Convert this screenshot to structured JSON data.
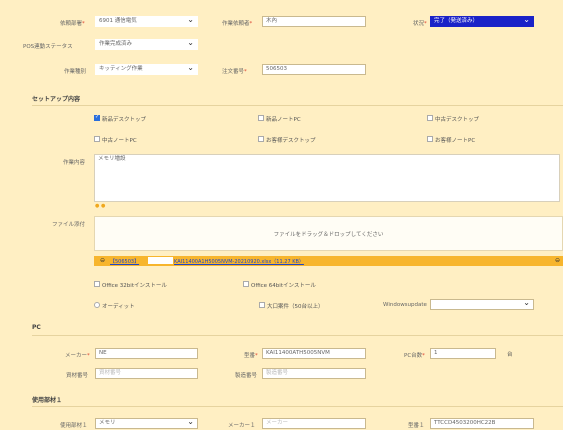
{
  "top": {
    "dept_label": "依頼部署",
    "dept_value": "6901 通信電気",
    "requester_label": "作業依頼者",
    "requester_value": "木內",
    "status_label": "状況",
    "status_value": "完了（発送済み）",
    "pos_label": "POS連動ステータス",
    "pos_value": "作業完成済み",
    "worktype_label": "作業種別",
    "worktype_value": "キッティング作業",
    "order_label": "注文番号",
    "order_value": "506503"
  },
  "setup": {
    "title": "セットアップ内容",
    "checkboxes": [
      {
        "label": "新品デスクトップ",
        "checked": true
      },
      {
        "label": "新品ノートPC",
        "checked": false
      },
      {
        "label": "中古デスクトップ",
        "checked": false
      },
      {
        "label": "中古ノートPC",
        "checked": false
      },
      {
        "label": "お客様デスクトップ",
        "checked": false
      },
      {
        "label": "お客様ノートPC",
        "checked": false
      }
    ],
    "work_label": "作業内容",
    "work_value": "メモリ増設",
    "icons": "● ●"
  },
  "file": {
    "label": "ファイル添付",
    "drop_text": "ファイルをドラッグ＆ドロップしてください",
    "attached_id": "【506503】",
    "attached_name": "KAI11400A1H5005NVM-20210920.xlsx（11.27 KB）",
    "delete_glyph": "⊖",
    "right_glyph": "⊖"
  },
  "options": {
    "office32": "Office 32bitインストール",
    "office64": "Office 64bitインストール",
    "audit": "オーディット",
    "bulk": "大口案件（50台以上）",
    "windows_update_label": "Windowsupdate"
  },
  "pc": {
    "title": "PC",
    "maker_label": "メーカー",
    "maker_value": "NE",
    "model_label": "型番",
    "model_value": "KAI11400ATH5005NVM",
    "count_label": "PC台数",
    "count_value": "1",
    "count_unit": "台",
    "asset_label": "資材番号",
    "asset_placeholder": "資材番号",
    "serial_label": "製造番号",
    "serial_placeholder": "製造番号"
  },
  "parts": {
    "title": "使用部材１",
    "part_label": "使用部材１",
    "part_value": "メモリ",
    "maker_label": "メーカー１",
    "maker_placeholder": "メーカー",
    "model_label": "型番１",
    "model_value": "TTCCD4503200HC22B"
  }
}
